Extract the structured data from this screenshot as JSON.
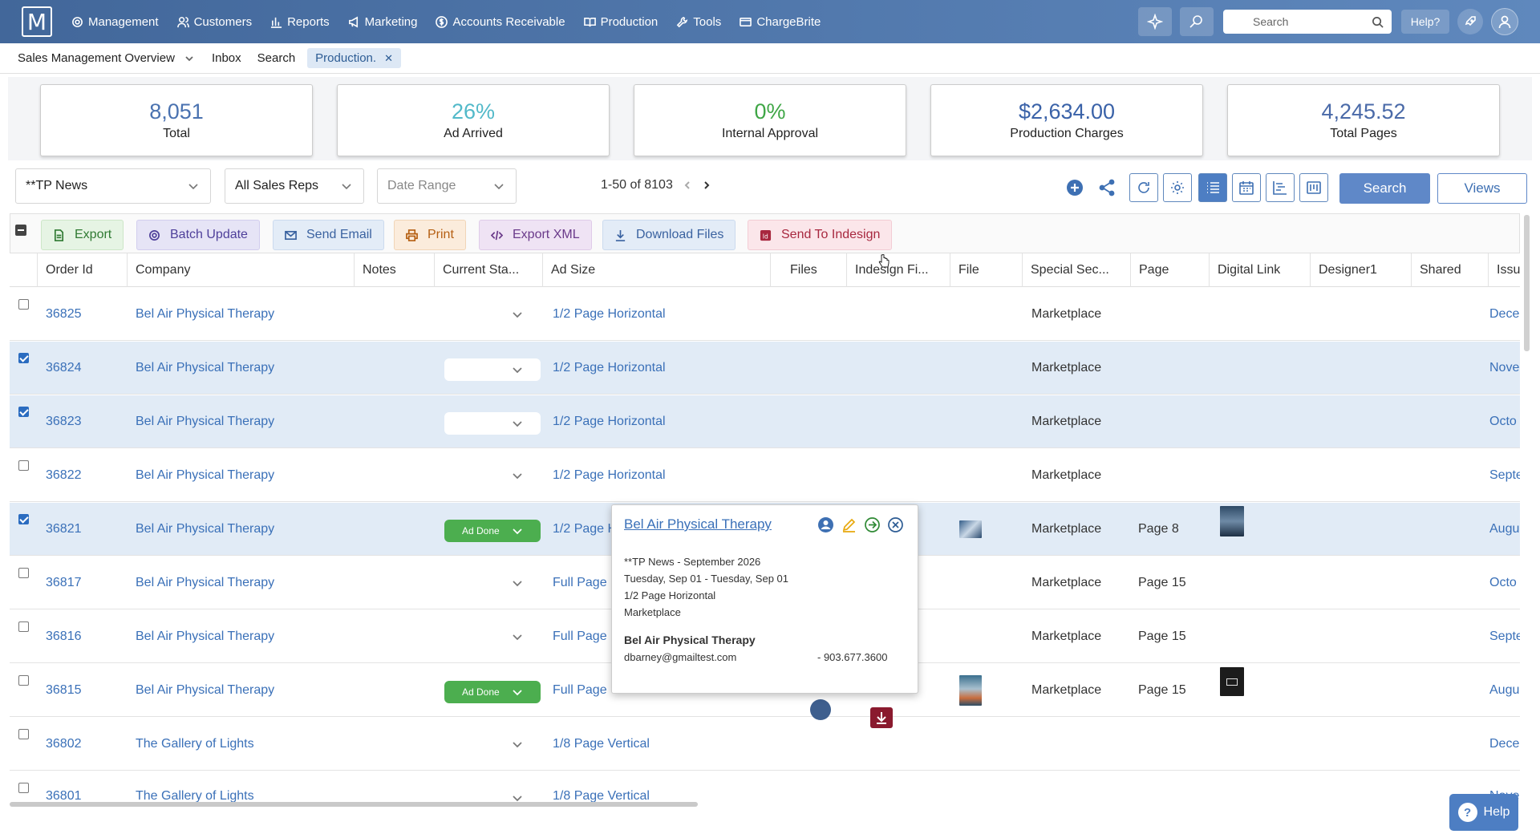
{
  "app": {
    "logo_letter": "M",
    "nav": [
      "Management",
      "Customers",
      "Reports",
      "Marketing",
      "Accounts Receivable",
      "Production",
      "Tools",
      "ChargeBrite"
    ],
    "search_placeholder": "Search",
    "help_label": "Help?"
  },
  "tabs": {
    "overview": "Sales Management Overview",
    "inbox": "Inbox",
    "search": "Search",
    "production": "Production.",
    "close": "✕"
  },
  "stats": [
    {
      "value": "8,051",
      "label": "Total",
      "color": "#4a72b0"
    },
    {
      "value": "26%",
      "label": "Ad Arrived",
      "color": "#52b9c9"
    },
    {
      "value": "0%",
      "label": "Internal Approval",
      "color": "#3fa646"
    },
    {
      "value": "$2,634.00",
      "label": "Production Charges",
      "color": "#3a62a8"
    },
    {
      "value": "4,245.52",
      "label": "Total Pages",
      "color": "#4a6aa8"
    }
  ],
  "filters": {
    "publication": "**TP News",
    "sales_reps": "All Sales Reps",
    "date_range": "Date Range",
    "pager": "1-50 of 8103",
    "search_btn": "Search",
    "views_btn": "Views"
  },
  "actions": {
    "export": "Export",
    "batch_update": "Batch Update",
    "send_email": "Send Email",
    "print": "Print",
    "export_xml": "Export XML",
    "download_files": "Download Files",
    "send_indesign": "Send To Indesign"
  },
  "columns": [
    "Order Id",
    "Company",
    "Notes",
    "Current Sta...",
    "Ad Size",
    "Files",
    "Indesign Fi...",
    "File",
    "Special Sec...",
    "Page",
    "Digital Link",
    "Designer1",
    "Shared",
    "Issue"
  ],
  "rows": [
    {
      "id": "36825",
      "company": "Bel Air Physical Therapy",
      "status": "",
      "adsize": "1/2 Page Horizontal",
      "special": "Marketplace",
      "page": "",
      "issue": "Dece"
    },
    {
      "id": "36824",
      "company": "Bel Air Physical Therapy",
      "status": "",
      "adsize": "1/2 Page Horizontal",
      "special": "Marketplace",
      "page": "",
      "issue": "Nove"
    },
    {
      "id": "36823",
      "company": "Bel Air Physical Therapy",
      "status": "",
      "adsize": "1/2 Page Horizontal",
      "special": "Marketplace",
      "page": "",
      "issue": "Octo"
    },
    {
      "id": "36822",
      "company": "Bel Air Physical Therapy",
      "status": "",
      "adsize": "1/2 Page Horizontal",
      "special": "Marketplace",
      "page": "",
      "issue": "Septe"
    },
    {
      "id": "36821",
      "company": "Bel Air Physical Therapy",
      "status": "Ad Done",
      "adsize": "1/2 Page H",
      "special": "Marketplace",
      "page": "Page 8",
      "issue": "Augu"
    },
    {
      "id": "36817",
      "company": "Bel Air Physical Therapy",
      "status": "",
      "adsize": "Full Page",
      "special": "Marketplace",
      "page": "Page 15",
      "issue": "Octo"
    },
    {
      "id": "36816",
      "company": "Bel Air Physical Therapy",
      "status": "",
      "adsize": "Full Page",
      "special": "Marketplace",
      "page": "Page 15",
      "issue": "Septe"
    },
    {
      "id": "36815",
      "company": "Bel Air Physical Therapy",
      "status": "Ad Done",
      "adsize": "Full Page",
      "special": "Marketplace",
      "page": "Page 15",
      "issue": "Augu"
    },
    {
      "id": "36802",
      "company": "The Gallery of Lights",
      "status": "",
      "adsize": "1/8 Page Vertical",
      "special": "",
      "page": "",
      "issue": "Dece"
    },
    {
      "id": "36801",
      "company": "The Gallery of Lights",
      "status": "",
      "adsize": "1/8 Page Vertical",
      "special": "",
      "page": "",
      "issue": "Nove"
    }
  ],
  "popup": {
    "title": "Bel Air Physical Therapy",
    "line1": "**TP News - September 2026",
    "line2": "Tuesday, Sep 01 - Tuesday, Sep 01",
    "line3": "1/2 Page Horizontal",
    "line4": "Marketplace",
    "contact_name": "Bel Air Physical Therapy",
    "email": "dbarney@gmailtest.com",
    "phone": "- 903.677.3600"
  },
  "help_float": "Help",
  "help_glyph": "?"
}
